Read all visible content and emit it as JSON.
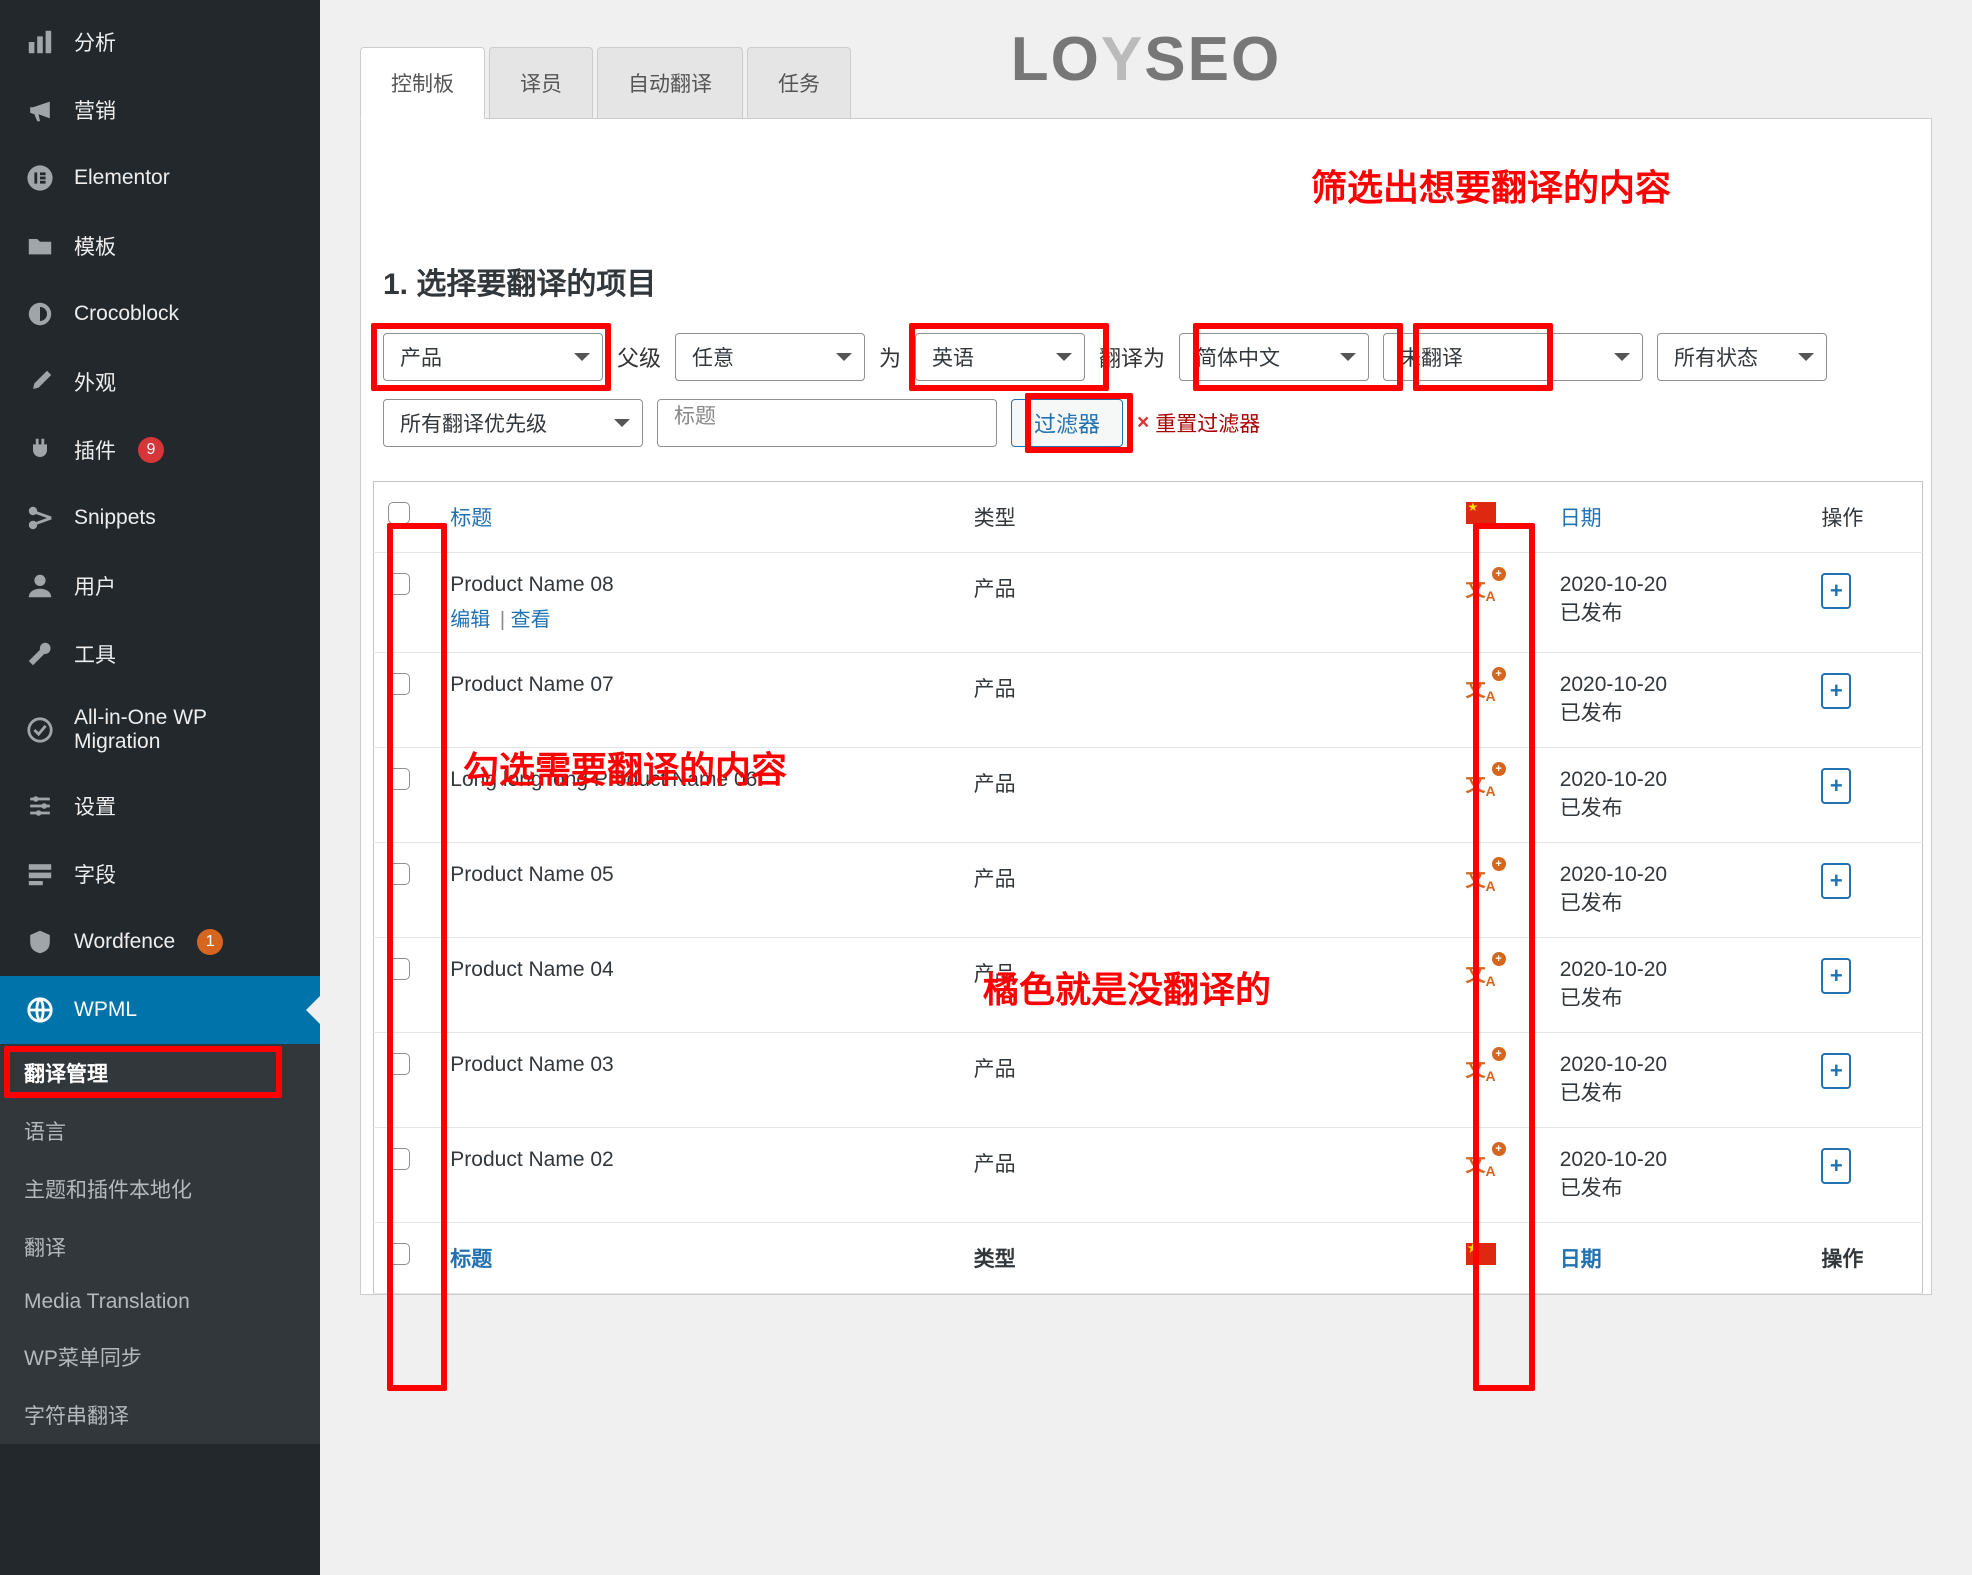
{
  "sidebar": {
    "items": [
      {
        "icon": "chart-bar",
        "label": "分析"
      },
      {
        "icon": "megaphone",
        "label": "营销"
      },
      {
        "icon": "elementor",
        "label": "Elementor"
      },
      {
        "icon": "folder",
        "label": "模板"
      },
      {
        "icon": "croco",
        "label": "Crocoblock"
      },
      {
        "icon": "brush",
        "label": "外观"
      },
      {
        "icon": "plug",
        "label": "插件",
        "badge": "9"
      },
      {
        "icon": "scissors",
        "label": "Snippets"
      },
      {
        "icon": "user",
        "label": "用户"
      },
      {
        "icon": "wrench",
        "label": "工具"
      },
      {
        "icon": "migrate",
        "label": "All-in-One WP Migration"
      },
      {
        "icon": "sliders",
        "label": "设置"
      },
      {
        "icon": "fields",
        "label": "字段"
      },
      {
        "icon": "shield",
        "label": "Wordfence",
        "badge": "1",
        "badge_class": "orange"
      },
      {
        "icon": "globe",
        "label": "WPML",
        "parent_active": true
      }
    ],
    "submenu": [
      {
        "label": "翻译管理",
        "current": true
      },
      {
        "label": "语言"
      },
      {
        "label": "主题和插件本地化"
      },
      {
        "label": "翻译"
      },
      {
        "label": "Media Translation"
      },
      {
        "label": "WP菜单同步"
      },
      {
        "label": "字符串翻译"
      }
    ]
  },
  "logo": {
    "pre": "LO",
    "mid": "Y",
    "post": "SEO"
  },
  "tabs": [
    "控制板",
    "译员",
    "自动翻译",
    "任务"
  ],
  "section_title": "1. 选择要翻译的项目",
  "filters": {
    "content_type": "产品",
    "parent_label": "父级",
    "parent": "任意",
    "from_label": "为",
    "from": "英语",
    "to_label": "翻译为",
    "to": "简体中文",
    "status": "未翻译",
    "all_status": "所有状态",
    "priority": "所有翻译优先级",
    "title_placeholder": "标题",
    "filter_btn": "过滤器",
    "reset": "重置过滤器"
  },
  "table": {
    "head": {
      "title": "标题",
      "type": "类型",
      "date": "日期",
      "action": "操作"
    },
    "rows": [
      {
        "title": "Product Name 08",
        "type": "产品",
        "date": "2020-10-20",
        "status": "已发布",
        "actions": {
          "edit": "编辑",
          "view": "查看"
        }
      },
      {
        "title": "Product Name 07",
        "type": "产品",
        "date": "2020-10-20",
        "status": "已发布"
      },
      {
        "title": "Long long long Product Name 06",
        "type": "产品",
        "date": "2020-10-20",
        "status": "已发布"
      },
      {
        "title": "Product Name 05",
        "type": "产品",
        "date": "2020-10-20",
        "status": "已发布"
      },
      {
        "title": "Product Name 04",
        "type": "产品",
        "date": "2020-10-20",
        "status": "已发布"
      },
      {
        "title": "Product Name 03",
        "type": "产品",
        "date": "2020-10-20",
        "status": "已发布"
      },
      {
        "title": "Product Name 02",
        "type": "产品",
        "date": "2020-10-20",
        "status": "已发布"
      }
    ]
  },
  "annotations": {
    "a1": "筛选出想要翻译的内容",
    "a2": "勾选需要翻译的内容",
    "a3": "橘色就是没翻译的"
  }
}
